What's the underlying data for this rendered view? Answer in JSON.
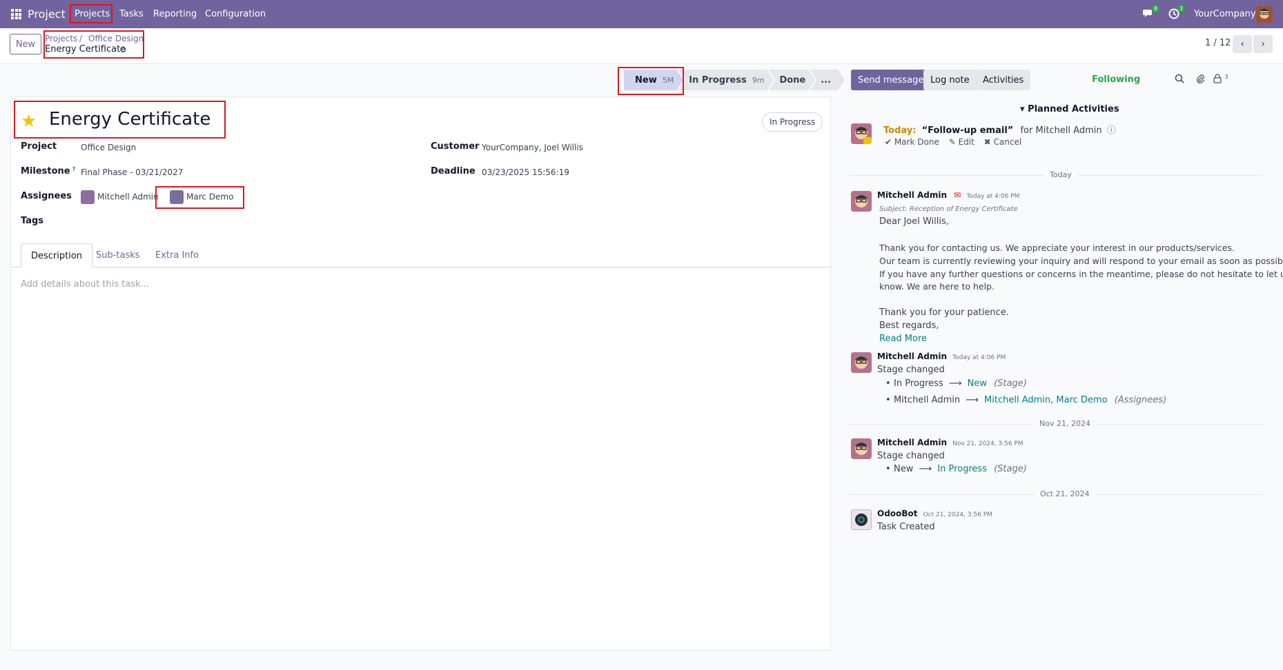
{
  "navbar": {
    "app_name": "Project",
    "menu": [
      "Projects",
      "Tasks",
      "Reporting",
      "Configuration"
    ],
    "messages_badge": "8",
    "activities_badge": "3",
    "company": "YourCompany"
  },
  "control_panel": {
    "new_label": "New",
    "breadcrumb": [
      "Projects",
      "Office Design"
    ],
    "breadcrumb_sep": "/",
    "current": "Energy Certificate",
    "pager": "1 / 12"
  },
  "statusbar": {
    "stages": [
      {
        "label": "New",
        "duration": "5M"
      },
      {
        "label": "In Progress",
        "duration": "9m"
      },
      {
        "label": "Done",
        "duration": ""
      },
      {
        "label": "...",
        "duration": ""
      }
    ]
  },
  "form": {
    "title": "Energy Certificate",
    "state_button": "In Progress",
    "fields": {
      "project_label": "Project",
      "project_value": "Office Design",
      "milestone_label": "Milestone",
      "milestone_help": "?",
      "milestone_value": "Final Phase - 03/21/2027",
      "assignees_label": "Assignees",
      "assignees": [
        "Mitchell Admin",
        "Marc Demo"
      ],
      "tags_label": "Tags",
      "customer_label": "Customer",
      "customer_value": "YourCompany, Joel Willis",
      "deadline_label": "Deadline",
      "deadline_value": "03/23/2025 15:56:19"
    },
    "tabs": [
      "Description",
      "Sub-tasks",
      "Extra Info"
    ],
    "description_placeholder": "Add details about this task..."
  },
  "chatter": {
    "send_message": "Send message",
    "log_note": "Log note",
    "activities": "Activities",
    "followers_count": "3",
    "following": "Following",
    "planned_activities": "Planned Activities",
    "activity": {
      "today": "Today:",
      "summary": "“Follow-up email”",
      "for_user": "for Mitchell Admin",
      "mark_done": "Mark Done",
      "edit": "Edit",
      "cancel": "Cancel"
    },
    "dates": [
      "Today",
      "Nov 21, 2024",
      "Oct 21, 2024"
    ],
    "messages": [
      {
        "author": "Mitchell Admin",
        "time": "Today at 4:06 PM",
        "subject": "Subject: Reception of Energy Certificate",
        "lines": [
          "Dear Joel Willis,",
          "Thank you for contacting us. We appreciate your interest in our products/services.",
          "Our team is currently reviewing your inquiry and will respond to your email as soon as possible.",
          "If you have any further questions or concerns in the meantime, please do not hesitate to let us",
          "know. We are here to help.",
          "Thank you for your patience.",
          "Best regards,"
        ],
        "read_more": "Read More"
      },
      {
        "author": "Mitchell Admin",
        "time": "Today at 4:06 PM",
        "body": "Stage changed",
        "changes": [
          {
            "old": "In Progress",
            "new": "New",
            "field": "(Stage)"
          },
          {
            "old": "Mitchell Admin",
            "new": "Mitchell Admin, Marc Demo",
            "field": "(Assignees)"
          }
        ]
      },
      {
        "author": "Mitchell Admin",
        "time": "Nov 21, 2024, 3:56 PM",
        "body": "Stage changed",
        "changes": [
          {
            "old": "New",
            "new": "In Progress",
            "field": "(Stage)"
          }
        ]
      },
      {
        "author": "OdooBot",
        "time": "Oct 21, 2024, 3:56 PM",
        "body": "Task Created"
      }
    ]
  },
  "colors": {
    "brand": "#71639e",
    "link_teal": "#017e84",
    "highlight_red": "#e0141e",
    "following_green": "#28a745",
    "star": "#f3c300"
  }
}
